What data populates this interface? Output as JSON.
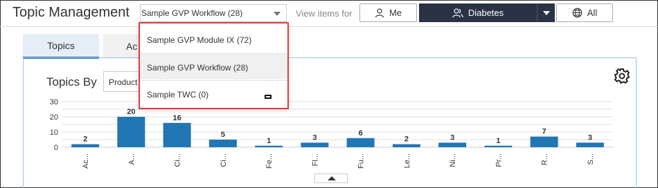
{
  "header": {
    "title": "Topic Management",
    "workflow_select_value": "Sample GVP Workflow (28)",
    "view_items_label": "View items for",
    "filter_me_label": "Me",
    "filter_diabetes_label": "Diabetes",
    "filter_all_label": "All"
  },
  "tabs": [
    {
      "label": "Topics",
      "active": true
    },
    {
      "label": "Ac",
      "active": false
    }
  ],
  "chart_panel": {
    "title": "Topics By",
    "group_by_select_value": "Product"
  },
  "workflow_dropdown": {
    "options": [
      {
        "label": "Sample GVP Module IX (72)"
      },
      {
        "label": "Sample GVP Workflow (28)",
        "selected": true
      },
      {
        "label": "Sample TWC (0)"
      }
    ]
  },
  "colors": {
    "accent_bar": "#2077b4",
    "dark_button": "#2a3346",
    "highlight_border": "#e03c3c"
  },
  "chart_data": {
    "type": "bar",
    "categories": [
      "Ac...",
      "A...",
      "Ci...",
      "Ci...",
      "Fe...",
      "Fl...",
      "Fu...",
      "Le...",
      "Ni...",
      "Pr...",
      "R...",
      "S..."
    ],
    "values": [
      2,
      20,
      16,
      5,
      1,
      3,
      6,
      2,
      3,
      1,
      7,
      3
    ],
    "yticks": [
      0,
      10,
      20,
      30
    ],
    "ylim": [
      0,
      30
    ],
    "grid": true
  }
}
